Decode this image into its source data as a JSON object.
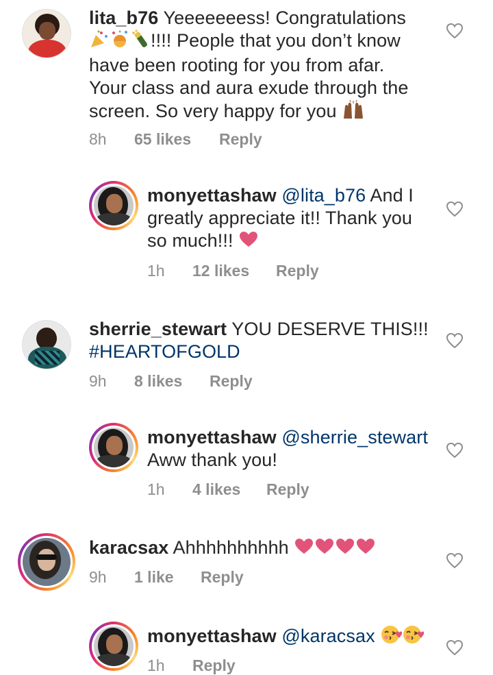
{
  "comments": [
    {
      "username": "lita_b76",
      "text": " Yeeeeeeess! Congratulations",
      "text2": "!!!! People that you don’t know",
      "text3": "have been rooting for you from afar.",
      "text4": "Your class and aura exude through the",
      "text5": "screen. So very happy for you",
      "time": "8h",
      "likes": "65 likes",
      "reply": "Reply",
      "emojis": [
        "party-popper",
        "confetti-ball",
        "champagne-bottle",
        "raising-hands"
      ]
    },
    {
      "username": "monyettashaw",
      "mention": "@lita_b76",
      "text": " And I",
      "text2": "greatly appreciate it!! Thank you",
      "text3": "so much!!!",
      "time": "1h",
      "likes": "12 likes",
      "reply": "Reply",
      "emojis": [
        "heart"
      ]
    },
    {
      "username": "sherrie_stewart",
      "text": " YOU DESERVE THIS!!!",
      "hashtag": "#HEARTOFGOLD",
      "time": "9h",
      "likes": "8 likes",
      "reply": "Reply"
    },
    {
      "username": "monyettashaw",
      "mention": "@sherrie_stewart",
      "text2": "Aww thank you!",
      "time": "1h",
      "likes": "4 likes",
      "reply": "Reply"
    },
    {
      "username": "karacsax",
      "text": " Ahhhhhhhhhh",
      "time": "9h",
      "likes": "1 like",
      "reply": "Reply",
      "emojis": [
        "heart",
        "heart",
        "heart",
        "heart"
      ]
    },
    {
      "username": "monyettashaw",
      "mention": "@karacsax",
      "time": "1h",
      "reply": "Reply",
      "emojis": [
        "kissing-face",
        "kissing-face"
      ]
    }
  ],
  "colors": {
    "text": "#262626",
    "meta": "#8e8e8e",
    "link": "#003569",
    "heart": "#e2537a"
  }
}
